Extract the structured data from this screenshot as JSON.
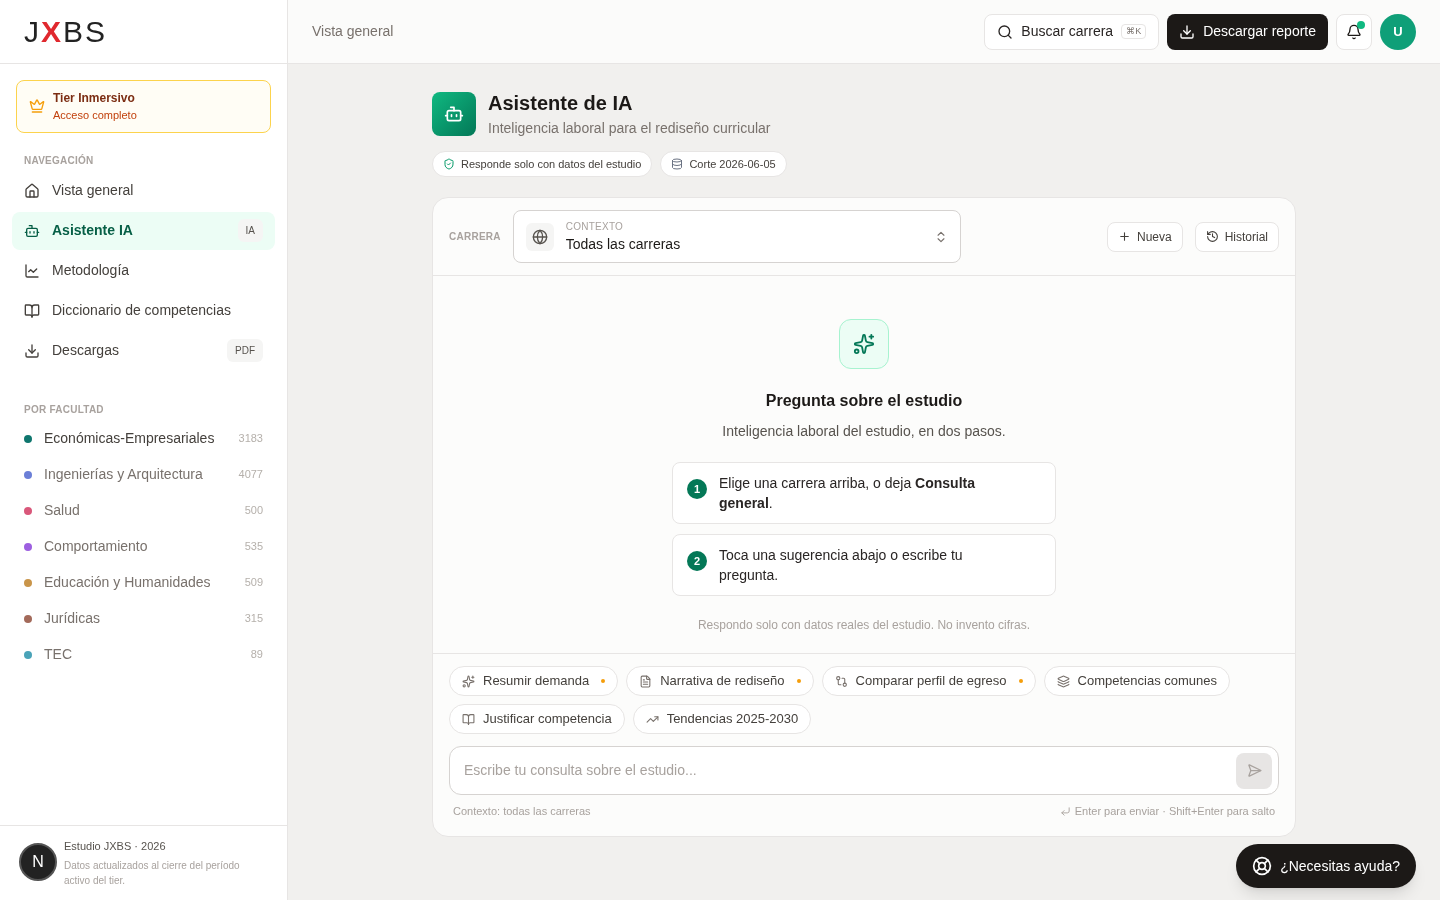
{
  "brand": {
    "logo_left": "J",
    "logo_mark": "X",
    "logo_right": "BS"
  },
  "tier": {
    "title": "Tier Inmersivo",
    "subtitle": "Acceso completo"
  },
  "nav": {
    "heading": "NAVEGACIÓN",
    "items": [
      {
        "label": "Vista general",
        "selected": false
      },
      {
        "label": "Asistente IA",
        "badge": "IA",
        "selected": true
      },
      {
        "label": "Metodología",
        "selected": false
      },
      {
        "label": "Diccionario de competencias",
        "selected": false
      },
      {
        "label": "Descargas",
        "badge": "PDF",
        "selected": false
      }
    ]
  },
  "faculties": {
    "heading": "POR FACULTAD",
    "items": [
      {
        "label": "Económicas-Empresariales",
        "count": "3183",
        "color": "#0f766e",
        "selected": true
      },
      {
        "label": "Ingenierías y Arquitectura",
        "count": "4077",
        "color": "#6b7fd7",
        "selected": false
      },
      {
        "label": "Salud",
        "count": "500",
        "color": "#d9577a",
        "selected": false
      },
      {
        "label": "Comportamiento",
        "count": "535",
        "color": "#9d5fe0",
        "selected": false
      },
      {
        "label": "Educación y Humanidades",
        "count": "509",
        "color": "#c9954a",
        "selected": false
      },
      {
        "label": "Jurídicas",
        "count": "315",
        "color": "#a36a5a",
        "selected": false
      },
      {
        "label": "TEC",
        "count": "89",
        "color": "#4aa3b8",
        "selected": false
      }
    ]
  },
  "sidebar_footer": {
    "title": "Estudio JXBS · 2026",
    "note": "Datos actualizados al cierre del período activo del tier.",
    "dev_badge": "N"
  },
  "topbar": {
    "breadcrumb": "Vista general",
    "search": {
      "label": "Buscar carrera",
      "shortcut": "⌘K"
    },
    "download": "Descargar reporte",
    "notification_dot": true,
    "avatar": "U"
  },
  "page": {
    "title": "Asistente de IA",
    "subtitle": "Inteligencia laboral para el rediseño curricular",
    "pills": [
      {
        "kind": "shield",
        "label": "Responde solo con datos del estudio"
      },
      {
        "kind": "database",
        "label": "Corte 2026-06-05"
      }
    ]
  },
  "chat": {
    "career_label": "CARRERA",
    "context_label": "CONTEXTO",
    "context_value": "Todas las carreras",
    "actions": [
      {
        "kind": "new",
        "label": "Nueva"
      },
      {
        "kind": "history",
        "label": "Historial"
      }
    ],
    "empty": {
      "title": "Pregunta sobre el estudio",
      "subtitle": "Inteligencia laboral del estudio, en dos pasos.",
      "steps": [
        {
          "number": "1",
          "text": "Elige una carrera arriba, o deja **Consulta general**."
        },
        {
          "number": "2",
          "text": "Toca una sugerencia abajo o escribe tu pregunta."
        }
      ],
      "note": "Respondo solo con datos reales del estudio. No invento cifras."
    },
    "suggestions": [
      {
        "label": "Resumir demanda",
        "flagged": true
      },
      {
        "label": "Narrativa de rediseño",
        "flagged": true
      },
      {
        "label": "Comparar perfil de egreso",
        "flagged": true
      },
      {
        "label": "Competencias comunes",
        "flagged": false
      },
      {
        "label": "Justificar competencia",
        "flagged": false
      },
      {
        "label": "Tendencias 2025-2030",
        "flagged": false
      }
    ],
    "input": {
      "placeholder": "Escribe tu consulta sobre el estudio..."
    },
    "context_hint": "Contexto: todas las carreras",
    "keys_hint": "Enter para enviar · Shift+Enter para salto"
  },
  "help_button": "¿Necesitas ayuda?"
}
